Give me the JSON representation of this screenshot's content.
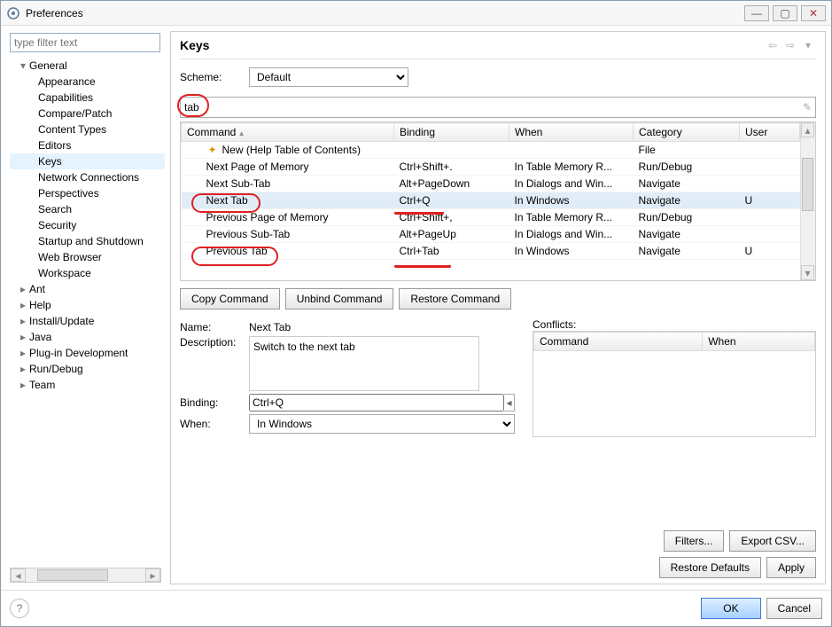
{
  "window": {
    "title": "Preferences"
  },
  "sidebar": {
    "filter_placeholder": "type filter text",
    "items": [
      {
        "label": "General",
        "level": 1,
        "expanded": true
      },
      {
        "label": "Appearance",
        "level": 2
      },
      {
        "label": "Capabilities",
        "level": 2
      },
      {
        "label": "Compare/Patch",
        "level": 2
      },
      {
        "label": "Content Types",
        "level": 2
      },
      {
        "label": "Editors",
        "level": 2
      },
      {
        "label": "Keys",
        "level": 2,
        "selected": true
      },
      {
        "label": "Network Connections",
        "level": 2
      },
      {
        "label": "Perspectives",
        "level": 2
      },
      {
        "label": "Search",
        "level": 2
      },
      {
        "label": "Security",
        "level": 2
      },
      {
        "label": "Startup and Shutdown",
        "level": 2
      },
      {
        "label": "Web Browser",
        "level": 2
      },
      {
        "label": "Workspace",
        "level": 2
      },
      {
        "label": "Ant",
        "level": 1
      },
      {
        "label": "Help",
        "level": 1
      },
      {
        "label": "Install/Update",
        "level": 1
      },
      {
        "label": "Java",
        "level": 1
      },
      {
        "label": "Plug-in Development",
        "level": 1
      },
      {
        "label": "Run/Debug",
        "level": 1
      },
      {
        "label": "Team",
        "level": 1
      }
    ]
  },
  "page": {
    "title": "Keys",
    "scheme_label": "Scheme:",
    "scheme_value": "Default",
    "filter_value": "tab",
    "columns": {
      "command": "Command",
      "binding": "Binding",
      "when": "When",
      "category": "Category",
      "user": "User"
    },
    "rows": [
      {
        "command": "New (Help Table of Contents)",
        "binding": "",
        "when": "",
        "category": "File",
        "user": "",
        "icon": true
      },
      {
        "command": "Next Page of Memory",
        "binding": "Ctrl+Shift+.",
        "when": "In Table Memory R...",
        "category": "Run/Debug",
        "user": ""
      },
      {
        "command": "Next Sub-Tab",
        "binding": "Alt+PageDown",
        "when": "In Dialogs and Win...",
        "category": "Navigate",
        "user": ""
      },
      {
        "command": "Next Tab",
        "binding": "Ctrl+Q",
        "when": "In Windows",
        "category": "Navigate",
        "user": "U",
        "selected": true
      },
      {
        "command": "Previous Page of Memory",
        "binding": "Ctrl+Shift+,",
        "when": "In Table Memory R...",
        "category": "Run/Debug",
        "user": ""
      },
      {
        "command": "Previous Sub-Tab",
        "binding": "Alt+PageUp",
        "when": "In Dialogs and Win...",
        "category": "Navigate",
        "user": ""
      },
      {
        "command": "Previous Tab",
        "binding": "Ctrl+Tab",
        "when": "In Windows",
        "category": "Navigate",
        "user": "U"
      }
    ],
    "buttons": {
      "copy": "Copy Command",
      "unbind": "Unbind Command",
      "restore_cmd": "Restore Command",
      "filters": "Filters...",
      "export": "Export CSV...",
      "restore_defaults": "Restore Defaults",
      "apply": "Apply"
    },
    "detail": {
      "name_label": "Name:",
      "name_value": "Next Tab",
      "description_label": "Description:",
      "description_value": "Switch to the next tab",
      "binding_label": "Binding:",
      "binding_value": "Ctrl+Q",
      "when_label": "When:",
      "when_value": "In Windows",
      "conflicts_label": "Conflicts:",
      "conflicts_columns": {
        "command": "Command",
        "when": "When"
      }
    }
  },
  "footer": {
    "ok": "OK",
    "cancel": "Cancel"
  }
}
